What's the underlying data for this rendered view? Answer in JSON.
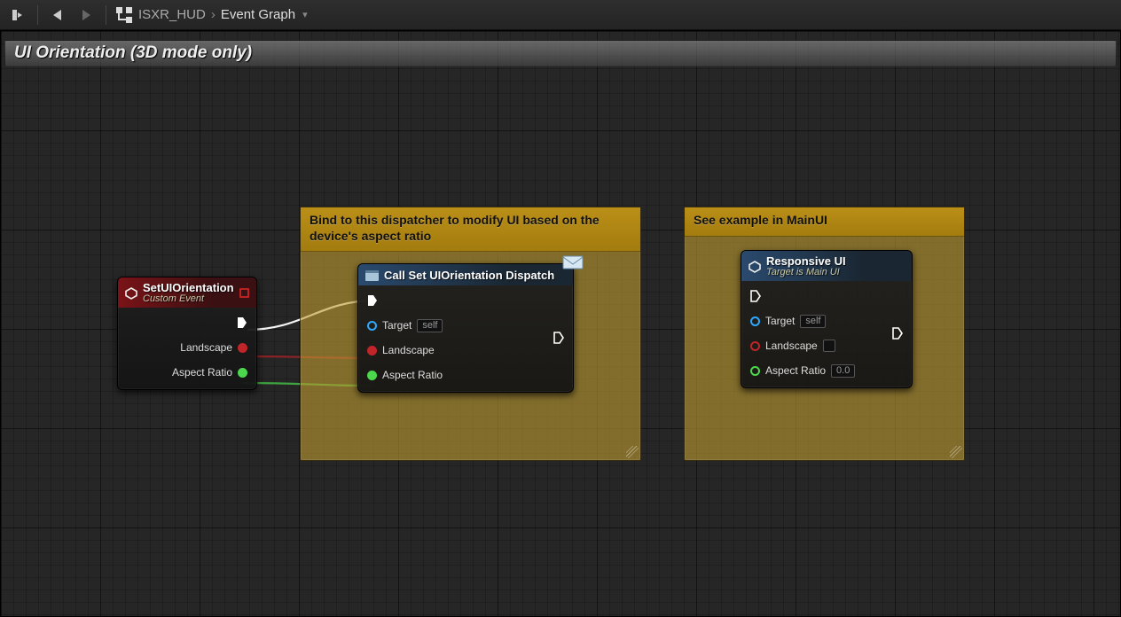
{
  "toolbar": {
    "breadcrumb": {
      "blueprint_name": "ISXR_HUD",
      "graph_name": "Event Graph"
    }
  },
  "section": {
    "title": "UI Orientation (3D mode only)"
  },
  "comments": {
    "bind": {
      "text": "Bind to this dispatcher to modify UI based on the device's aspect ratio"
    },
    "example": {
      "text": "See example in MainUI"
    }
  },
  "nodes": {
    "set_orientation_event": {
      "title": "SetUIOrientation",
      "subtitle": "Custom Event",
      "outputs": {
        "delegate": "",
        "exec": "",
        "landscape": "Landscape",
        "aspect_ratio": "Aspect Ratio"
      }
    },
    "call_dispatch": {
      "title": "Call Set UIOrientation Dispatch",
      "inputs": {
        "exec": "",
        "target": "Target",
        "target_value": "self",
        "landscape": "Landscape",
        "aspect_ratio": "Aspect Ratio"
      },
      "outputs": {
        "exec": ""
      }
    },
    "responsive_ui": {
      "title": "Responsive UI",
      "subtitle": "Target is Main UI",
      "inputs": {
        "exec": "",
        "target": "Target",
        "target_value": "self",
        "landscape": "Landscape",
        "aspect_ratio": "Aspect Ratio",
        "aspect_ratio_value": "0.0"
      },
      "outputs": {
        "exec": ""
      }
    }
  }
}
